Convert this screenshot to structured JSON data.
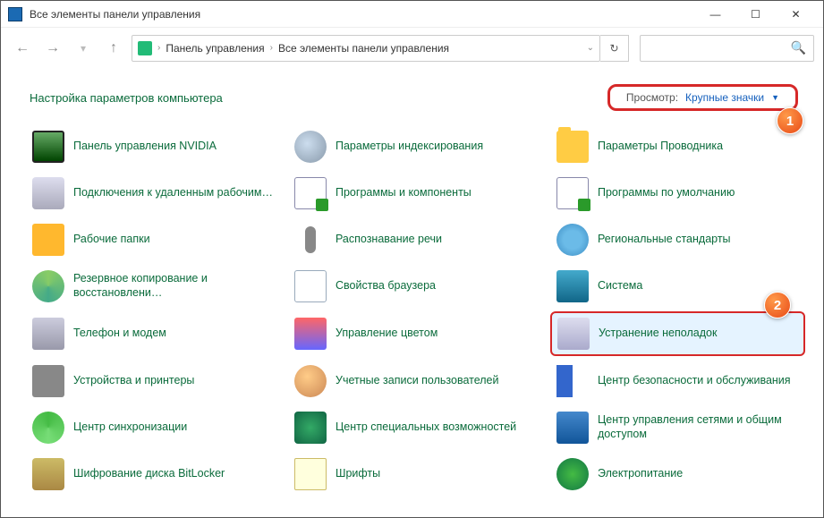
{
  "window": {
    "title": "Все элементы панели управления"
  },
  "breadcrumb": {
    "root": "Панель управления",
    "current": "Все элементы панели управления"
  },
  "header": {
    "label": "Настройка параметров компьютера"
  },
  "view": {
    "label": "Просмотр:",
    "value": "Крупные значки"
  },
  "callouts": {
    "c1": "1",
    "c2": "2"
  },
  "items": {
    "r0c0": "Панель управления NVIDIA",
    "r0c1": "Параметры индексирования",
    "r0c2": "Параметры Проводника",
    "r1c0": "Подключения к удаленным рабочим…",
    "r1c1": "Программы и компоненты",
    "r1c2": "Программы по умолчанию",
    "r2c0": "Рабочие папки",
    "r2c1": "Распознавание речи",
    "r2c2": "Региональные стандарты",
    "r3c0": "Резервное копирование и восстановлени…",
    "r3c1": "Свойства браузера",
    "r3c2": "Система",
    "r4c0": "Телефон и модем",
    "r4c1": "Управление цветом",
    "r4c2": "Устранение неполадок",
    "r5c0": "Устройства и принтеры",
    "r5c1": "Учетные записи пользователей",
    "r5c2": "Центр безопасности и обслуживания",
    "r6c0": "Центр синхронизации",
    "r6c1": "Центр специальных возможностей",
    "r6c2": "Центр управления сетями и общим доступом",
    "r7c0": "Шифрование диска BitLocker",
    "r7c1": "Шрифты",
    "r7c2": "Электропитание"
  }
}
